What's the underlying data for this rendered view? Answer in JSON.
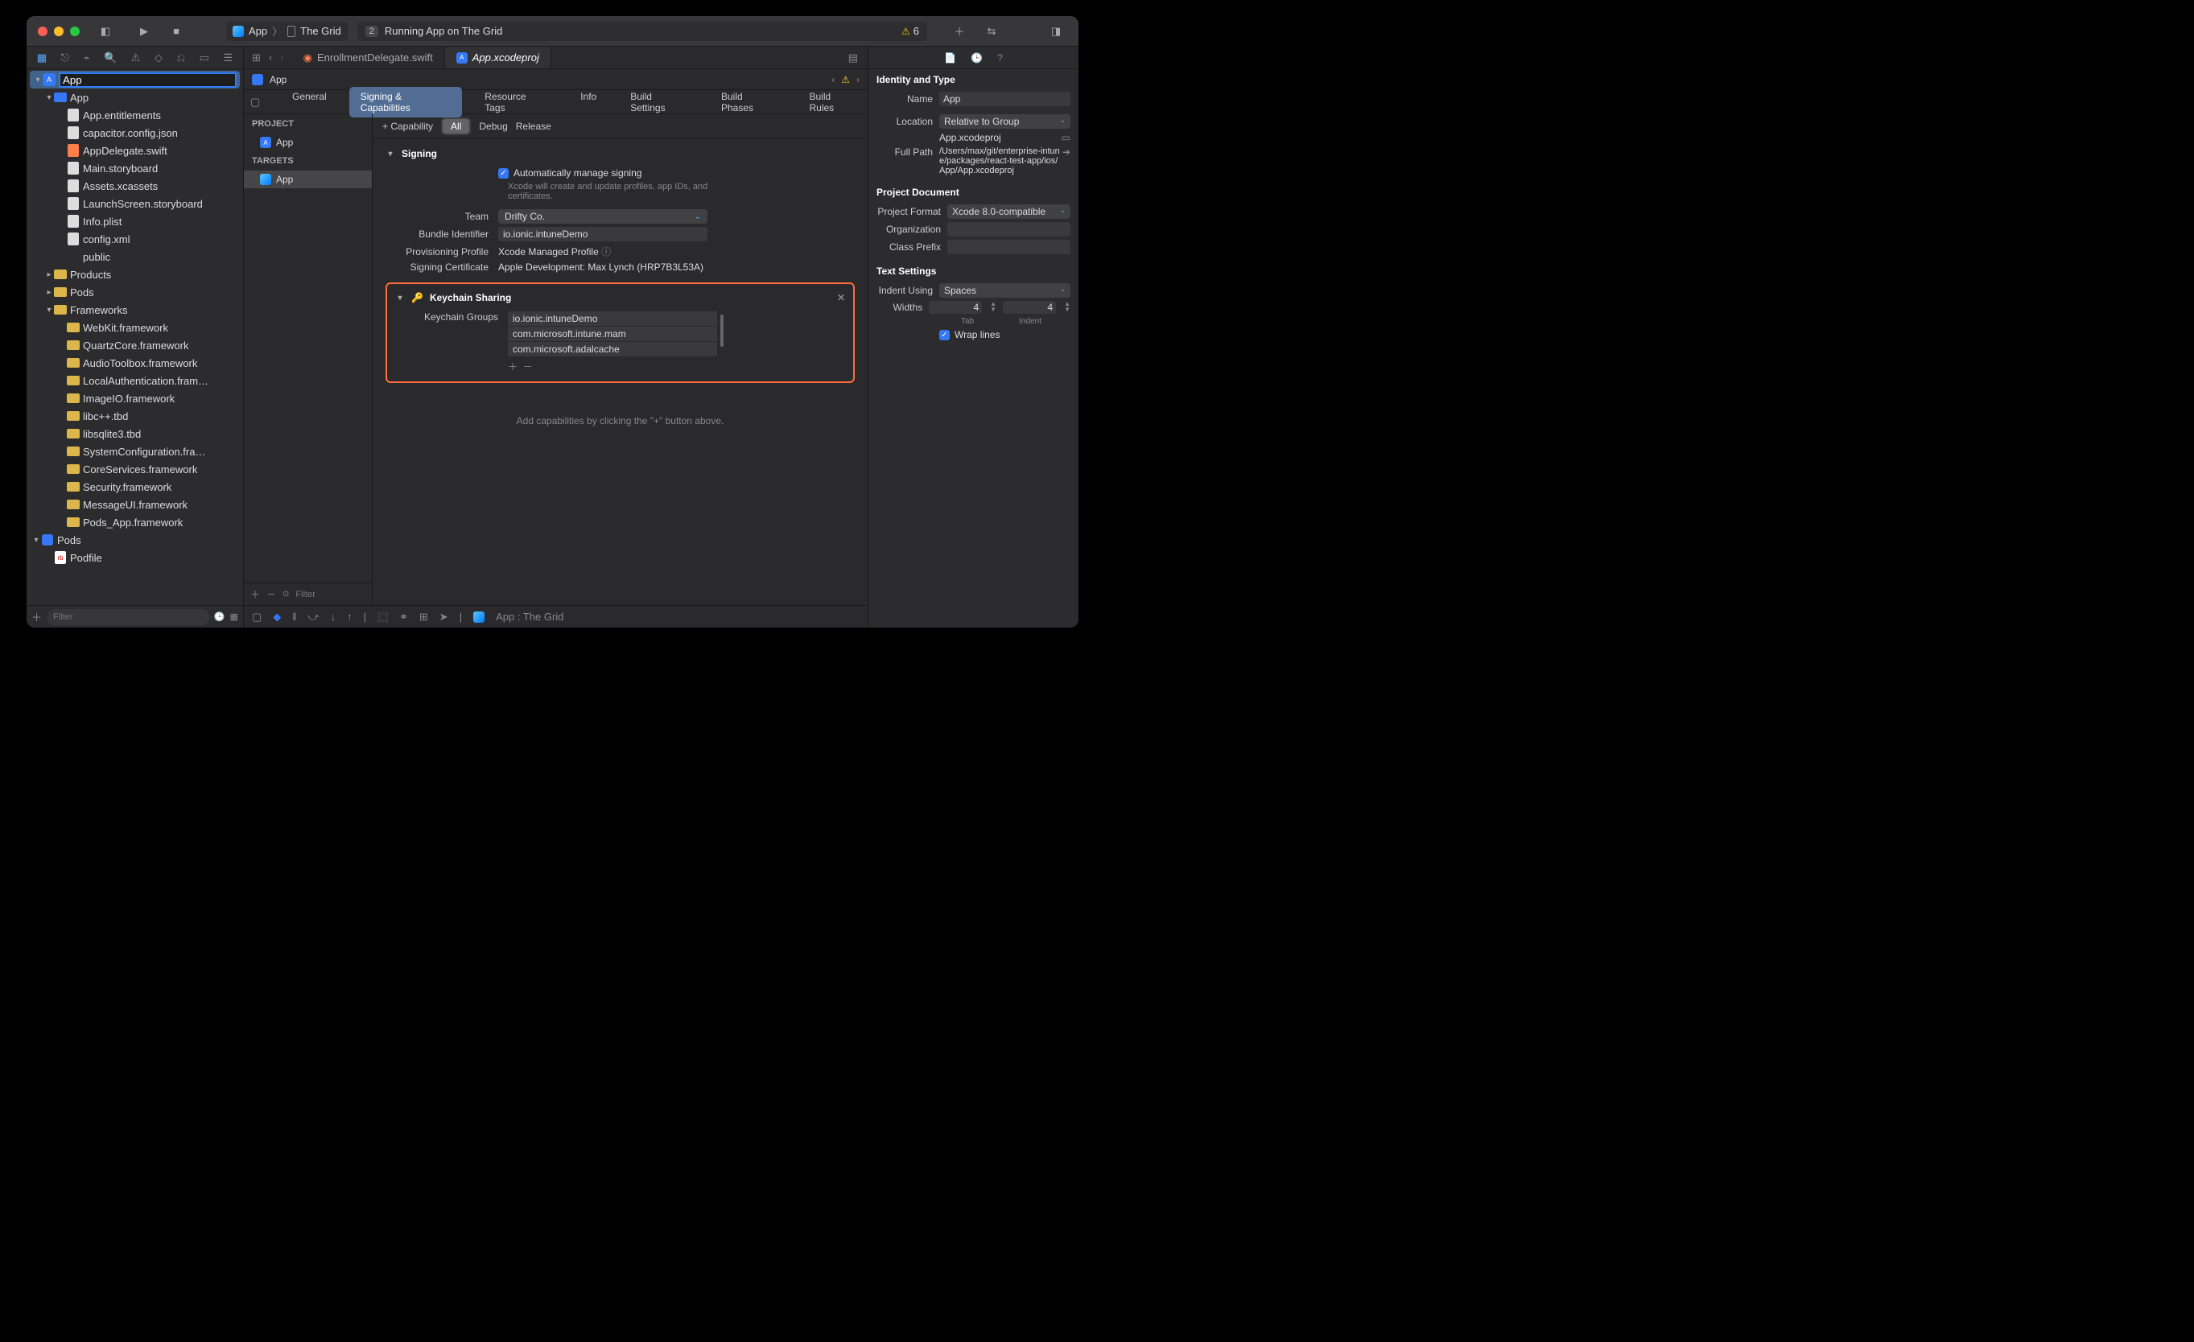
{
  "toolbar": {
    "scheme": "App",
    "device": "The Grid",
    "status_count": "2",
    "status_text": "Running App on The Grid",
    "warn_count": "6"
  },
  "tabs": {
    "t1_label": "EnrollmentDelegate.swift",
    "t2_label": "App.xcodeproj"
  },
  "jump": {
    "project": "App"
  },
  "navigator": {
    "root": "App",
    "items": [
      {
        "indent": 1,
        "icon": "folder",
        "label": "App",
        "disc": "v"
      },
      {
        "indent": 2,
        "icon": "file",
        "label": "App.entitlements"
      },
      {
        "indent": 2,
        "icon": "file",
        "label": "capacitor.config.json"
      },
      {
        "indent": 2,
        "icon": "swift",
        "label": "AppDelegate.swift"
      },
      {
        "indent": 2,
        "icon": "file",
        "label": "Main.storyboard"
      },
      {
        "indent": 2,
        "icon": "file",
        "label": "Assets.xcassets"
      },
      {
        "indent": 2,
        "icon": "file",
        "label": "LaunchScreen.storyboard"
      },
      {
        "indent": 2,
        "icon": "file",
        "label": "Info.plist"
      },
      {
        "indent": 2,
        "icon": "file",
        "label": "config.xml"
      },
      {
        "indent": 2,
        "icon": "none",
        "label": "public"
      },
      {
        "indent": 1,
        "icon": "folder-y",
        "label": "Products",
        "disc": ">"
      },
      {
        "indent": 1,
        "icon": "folder-y",
        "label": "Pods",
        "disc": ">"
      },
      {
        "indent": 1,
        "icon": "folder-y",
        "label": "Frameworks",
        "disc": "v"
      },
      {
        "indent": 2,
        "icon": "fw",
        "label": "WebKit.framework"
      },
      {
        "indent": 2,
        "icon": "fw",
        "label": "QuartzCore.framework"
      },
      {
        "indent": 2,
        "icon": "fw",
        "label": "AudioToolbox.framework"
      },
      {
        "indent": 2,
        "icon": "fw",
        "label": "LocalAuthentication.fram…"
      },
      {
        "indent": 2,
        "icon": "fw",
        "label": "ImageIO.framework"
      },
      {
        "indent": 2,
        "icon": "fw",
        "label": "libc++.tbd"
      },
      {
        "indent": 2,
        "icon": "fw",
        "label": "libsqlite3.tbd"
      },
      {
        "indent": 2,
        "icon": "fw",
        "label": "SystemConfiguration.fra…"
      },
      {
        "indent": 2,
        "icon": "fw",
        "label": "CoreServices.framework"
      },
      {
        "indent": 2,
        "icon": "fw",
        "label": "Security.framework"
      },
      {
        "indent": 2,
        "icon": "fw",
        "label": "MessageUI.framework"
      },
      {
        "indent": 2,
        "icon": "fw",
        "label": "Pods_App.framework"
      },
      {
        "indent": 0,
        "icon": "pods",
        "label": "Pods",
        "disc": "v"
      },
      {
        "indent": 1,
        "icon": "rb",
        "label": "Podfile"
      }
    ],
    "filter_placeholder": "Filter"
  },
  "peTabs": {
    "general": "General",
    "signing": "Signing & Capabilities",
    "resource": "Resource Tags",
    "info": "Info",
    "buildSettings": "Build Settings",
    "buildPhases": "Build Phases",
    "buildRules": "Build Rules"
  },
  "targets": {
    "project_header": "PROJECT",
    "project_item": "App",
    "targets_header": "TARGETS",
    "target_item": "App",
    "filter_placeholder": "Filter"
  },
  "caps": {
    "add_cap": "+ Capability",
    "all": "All",
    "debug": "Debug",
    "release": "Release",
    "signing_title": "Signing",
    "auto_label": "Automatically manage signing",
    "auto_hint": "Xcode will create and update profiles, app IDs, and certificates.",
    "team_label": "Team",
    "team_value": "Drifty Co.",
    "bundle_label": "Bundle Identifier",
    "bundle_value": "io.ionic.intuneDemo",
    "profile_label": "Provisioning Profile",
    "profile_value": "Xcode Managed Profile",
    "cert_label": "Signing Certificate",
    "cert_value": "Apple Development: Max Lynch (HRP7B3L53A)",
    "keychain_title": "Keychain Sharing",
    "kg_label": "Keychain Groups",
    "kg_items": [
      "io.ionic.intuneDemo",
      "com.microsoft.intune.mam",
      "com.microsoft.adalcache"
    ],
    "hint": "Add capabilities by clicking the \"+\" button above."
  },
  "debug": {
    "scheme": "App : The Grid"
  },
  "inspector": {
    "identity_title": "Identity and Type",
    "name_label": "Name",
    "name_value": "App",
    "location_label": "Location",
    "location_value": "Relative to Group",
    "filename": "App.xcodeproj",
    "fullpath_label": "Full Path",
    "fullpath_value": "/Users/max/git/enterprise-intune/packages/react-test-app/ios/App/App.xcodeproj",
    "pd_title": "Project Document",
    "format_label": "Project Format",
    "format_value": "Xcode 8.0-compatible",
    "org_label": "Organization",
    "prefix_label": "Class Prefix",
    "ts_title": "Text Settings",
    "indent_label": "Indent Using",
    "indent_value": "Spaces",
    "widths_label": "Widths",
    "tab_val": "4",
    "indent_val": "4",
    "tab_caption": "Tab",
    "indent_caption": "Indent",
    "wrap_label": "Wrap lines"
  }
}
